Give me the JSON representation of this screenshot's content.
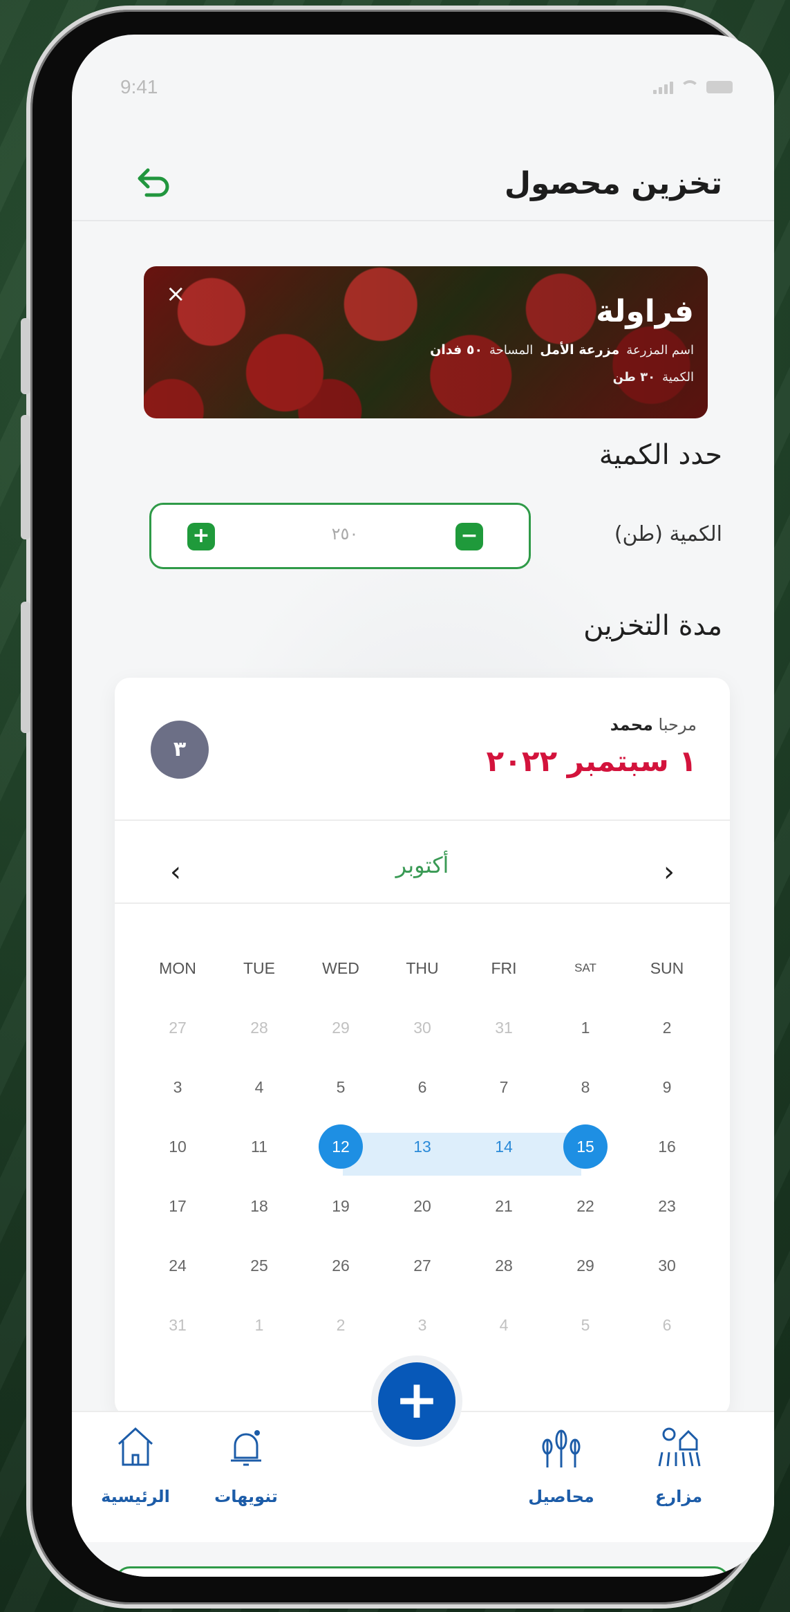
{
  "status": {
    "time": "9:41"
  },
  "header": {
    "title": "تخزين محصول",
    "back_icon": "undo-arrow-icon"
  },
  "product": {
    "name": "فراولة",
    "farm_label": "اسم المزرعة",
    "farm_value": "مزرعة الأمل",
    "area_label": "المساحة",
    "area_value": "٥٠ فدان",
    "qty_label": "الكمية",
    "qty_value": "٣٠ طن",
    "close": "×"
  },
  "quantity_section": {
    "title": "حدد الكمية",
    "label": "الكمية (طن)",
    "value": "٢٥٠",
    "plus": "+",
    "minus": "−"
  },
  "storage_section": {
    "title": "مدة التخزين"
  },
  "calendar": {
    "greeting_prefix": "مرحبا",
    "user_name": "محمد",
    "date_text": "١ سبتمبر ٢٠٢٢",
    "avatar_text": "٣",
    "month": "أكتوبر",
    "prev": "‹",
    "next": "›",
    "weekdays": [
      "MON",
      "TUE",
      "WED",
      "THU",
      "FRI",
      "SAT",
      "SUN"
    ],
    "weeks": [
      [
        "27",
        "28",
        "29",
        "30",
        "31",
        "1",
        "2"
      ],
      [
        "3",
        "4",
        "5",
        "6",
        "7",
        "8",
        "9"
      ],
      [
        "10",
        "11",
        "12",
        "13",
        "14",
        "15",
        "16"
      ],
      [
        "17",
        "18",
        "19",
        "20",
        "21",
        "22",
        "23"
      ],
      [
        "24",
        "25",
        "26",
        "27",
        "28",
        "29",
        "30"
      ],
      [
        "31",
        "1",
        "2",
        "3",
        "4",
        "5",
        "6"
      ]
    ],
    "range_start": "12",
    "range_end": "15",
    "accent_color": "#1e8fe3"
  },
  "bottom_nav": {
    "fab": "+",
    "items": [
      {
        "label": "الرئيسية",
        "icon": "home-icon"
      },
      {
        "label": "تنويهات",
        "icon": "bell-icon"
      },
      {
        "label": "محاصيل",
        "icon": "crops-icon"
      },
      {
        "label": "مزارع",
        "icon": "farm-icon"
      }
    ]
  },
  "colors": {
    "brand_green": "#1f9a3b",
    "nav_blue": "#1c5ca8",
    "fab_blue": "#0758b8",
    "date_red": "#d3133c"
  }
}
